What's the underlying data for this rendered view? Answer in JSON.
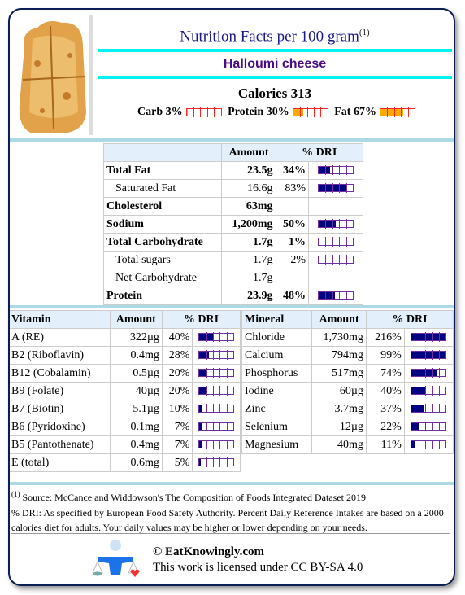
{
  "header": {
    "title": "Nutrition Facts per 100 gram",
    "title_note": "(1)",
    "food_name": "Halloumi cheese",
    "calories": "Calories 313"
  },
  "macros": [
    {
      "label": "Carb 3%",
      "pct": 3
    },
    {
      "label": "Protein 30%",
      "pct": 30
    },
    {
      "label": "Fat 67%",
      "pct": 67
    }
  ],
  "main_table": {
    "headers": [
      "Amount",
      "% DRI"
    ],
    "rows": [
      {
        "name": "Total Fat",
        "amount": "23.5g",
        "dri": "34%",
        "pct": 34,
        "bold": true
      },
      {
        "name": "Saturated Fat",
        "amount": "16.6g",
        "dri": "83%",
        "pct": 83,
        "bold": false
      },
      {
        "name": "Cholesterol",
        "amount": "63mg",
        "dri": "",
        "pct": null,
        "bold": true
      },
      {
        "name": "Sodium",
        "amount": "1,200mg",
        "dri": "50%",
        "pct": 50,
        "bold": true
      },
      {
        "name": "Total Carbohydrate",
        "amount": "1.7g",
        "dri": "1%",
        "pct": 1,
        "bold": true
      },
      {
        "name": "Total sugars",
        "amount": "1.7g",
        "dri": "2%",
        "pct": 2,
        "bold": false
      },
      {
        "name": "Net Carbohydrate",
        "amount": "1.7g",
        "dri": "",
        "pct": null,
        "bold": false
      },
      {
        "name": "Protein",
        "amount": "23.9g",
        "dri": "48%",
        "pct": 48,
        "bold": true
      }
    ]
  },
  "vitamins": {
    "headers": [
      "Vitamin",
      "Amount",
      "% DRI"
    ],
    "rows": [
      {
        "name": "A (RE)",
        "amount": "322µg",
        "dri": "40%",
        "pct": 40
      },
      {
        "name": "B2 (Riboflavin)",
        "amount": "0.4mg",
        "dri": "28%",
        "pct": 28
      },
      {
        "name": "B12 (Cobalamin)",
        "amount": "0.5µg",
        "dri": "20%",
        "pct": 20
      },
      {
        "name": "B9 (Folate)",
        "amount": "40µg",
        "dri": "20%",
        "pct": 20
      },
      {
        "name": "B7 (Biotin)",
        "amount": "5.1µg",
        "dri": "10%",
        "pct": 10
      },
      {
        "name": "B6 (Pyridoxine)",
        "amount": "0.1mg",
        "dri": "7%",
        "pct": 7
      },
      {
        "name": "B5 (Pantothenate)",
        "amount": "0.4mg",
        "dri": "7%",
        "pct": 7
      },
      {
        "name": "E (total)",
        "amount": "0.6mg",
        "dri": "5%",
        "pct": 5
      }
    ]
  },
  "minerals": {
    "headers": [
      "Mineral",
      "Amount",
      "% DRI"
    ],
    "rows": [
      {
        "name": "Chloride",
        "amount": "1,730mg",
        "dri": "216%",
        "pct": 216
      },
      {
        "name": "Calcium",
        "amount": "794mg",
        "dri": "99%",
        "pct": 99
      },
      {
        "name": "Phosphorus",
        "amount": "517mg",
        "dri": "74%",
        "pct": 74
      },
      {
        "name": "Iodine",
        "amount": "60µg",
        "dri": "40%",
        "pct": 40
      },
      {
        "name": "Zinc",
        "amount": "3.7mg",
        "dri": "37%",
        "pct": 37
      },
      {
        "name": "Selenium",
        "amount": "12µg",
        "dri": "22%",
        "pct": 22
      },
      {
        "name": "Magnesium",
        "amount": "40mg",
        "dri": "11%",
        "pct": 11
      }
    ]
  },
  "footer": {
    "source_note": "(1)",
    "source": "Source: McCance and Widdowson's The Composition of Foods Integrated Dataset 2019",
    "dri_note": "% DRI: As specified by European Food Safety Authority. Percent Daily Reference Intakes are based on a 2000 calories diet for adults. Your daily values may be higher or lower depending on your needs.",
    "site": "© EatKnowingly.com",
    "license": "This work is licensed under CC BY-SA 4.0"
  },
  "colors": {
    "title": "#1a1a8c",
    "food_name": "#4b0c82",
    "cyan_rule": "#00f2f2",
    "separator": "#add8e6",
    "bar_fill": "#000080",
    "bar_border": "#7030a0",
    "macro_fill": "#ffaa00",
    "macro_border": "#ff2222"
  }
}
